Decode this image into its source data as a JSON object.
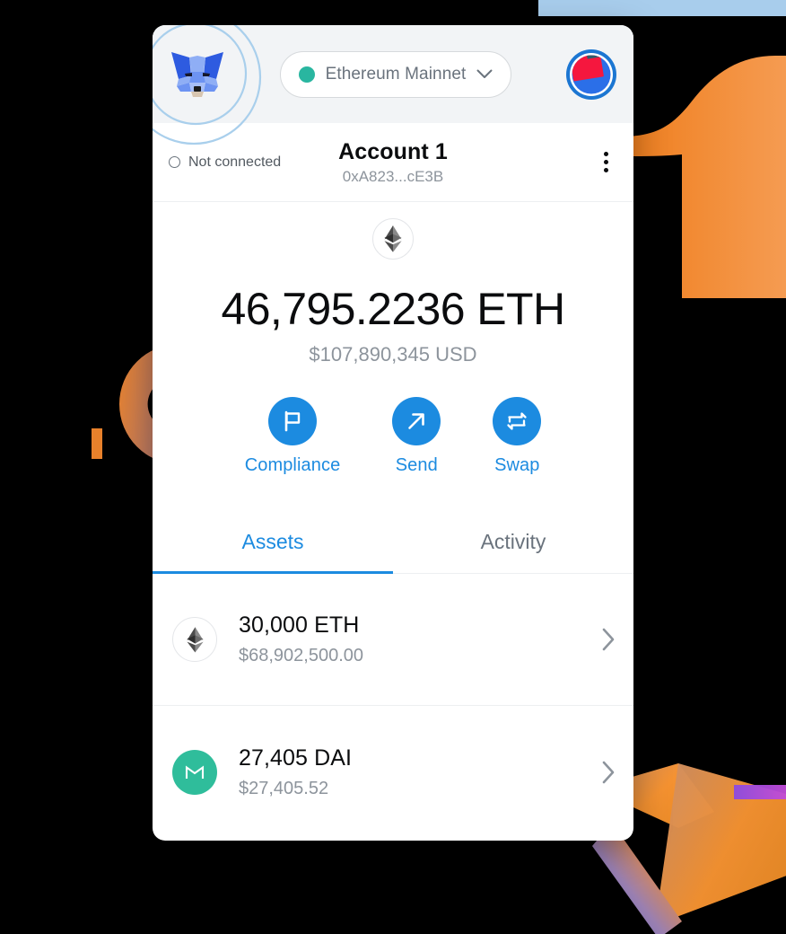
{
  "app": {
    "name": "MetaMask",
    "logo_icon": "metamask-fox-icon"
  },
  "header": {
    "network": {
      "label": "Ethereum Mainnet",
      "status_dot_color": "#29B6A0",
      "chevron_icon": "chevron-down-icon"
    },
    "avatar_icon": "account-jazzicon-avatar"
  },
  "account": {
    "connection_status": "Not connected",
    "connection_icon": "empty-circle-icon",
    "name": "Account 1",
    "address": "0xA823...cE3B",
    "menu_icon": "kebab-menu-icon"
  },
  "balance": {
    "token_icon": "ethereum-icon",
    "primary": "46,795.2236 ETH",
    "secondary": "$107,890,345 USD"
  },
  "actions": [
    {
      "label": "Compliance",
      "icon": "flag-icon"
    },
    {
      "label": "Send",
      "icon": "arrow-up-right-icon"
    },
    {
      "label": "Swap",
      "icon": "swap-arrows-icon"
    }
  ],
  "tabs": [
    {
      "label": "Assets",
      "active": true
    },
    {
      "label": "Activity",
      "active": false
    }
  ],
  "assets": [
    {
      "amount": "30,000 ETH",
      "fiat": "$68,902,500.00",
      "icon": "ethereum-icon",
      "chevron_icon": "chevron-right-icon"
    },
    {
      "amount": "27,405 DAI",
      "fiat": "$27,405.52",
      "icon": "maker-dai-icon",
      "chevron_icon": "chevron-right-icon"
    }
  ],
  "colors": {
    "accent_blue": "#1C8BE0",
    "network_green": "#29B6A0",
    "dai_teal": "#2FBD9B",
    "text_primary": "#0B0C0E",
    "text_muted": "#8D949C",
    "header_bg": "#F2F4F6",
    "canvas_bg": "#000000",
    "deco_orange": "#F6943A",
    "deco_blue_strip": "#A8CDEC",
    "deco_purple": "#8B4AE2"
  }
}
